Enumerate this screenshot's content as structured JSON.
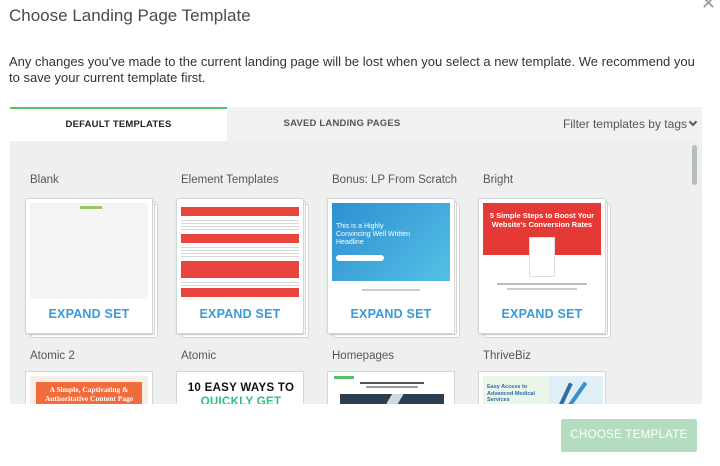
{
  "modal": {
    "title": "Choose Landing Page Template",
    "close_icon": "close-icon",
    "notice": "Any changes you've made to the current landing page will be lost when you select a new template. We recommend you to save your current template first."
  },
  "tabs": {
    "default_label": "DEFAULT TEMPLATES",
    "saved_label": "SAVED LANDING PAGES",
    "filter_label": "Filter templates by tags",
    "filter_icon": "chevron-down-icon"
  },
  "templates": [
    {
      "name": "Blank",
      "action": "EXPAND SET"
    },
    {
      "name": "Element Templates",
      "action": "EXPAND SET"
    },
    {
      "name": "Bonus: LP From Scratch",
      "action": "EXPAND SET"
    },
    {
      "name": "Bright",
      "action": "EXPAND SET"
    },
    {
      "name": "Atomic 2"
    },
    {
      "name": "Atomic"
    },
    {
      "name": "Homepages"
    },
    {
      "name": "ThriveBiz"
    }
  ],
  "thumb_text": {
    "bonus_headline": "This is a Highly Convincing Well Written Headline",
    "bright_headline": "5 Simple Steps to Boost Your Website's Conversion Rates",
    "atomic2_headline": "A Simple, Captivating & Authoritative Content Page",
    "atomic_headline": "10 EASY WAYS TO",
    "atomic_subline": "QUICKLY GET MORE",
    "thrivebiz_headline": "Easy Access to Advanced Medical Services"
  },
  "colors": {
    "accent_green": "#5bbf6a",
    "link_blue": "#3a9bd5",
    "button_disabled": "#b4dcc0",
    "element_red": "#e8453c",
    "bright_red": "#e53935",
    "bonus_blue": "#3aa3d8",
    "atomic_orange": "#f26b3a"
  },
  "footer": {
    "choose_label": "CHOOSE TEMPLATE"
  }
}
